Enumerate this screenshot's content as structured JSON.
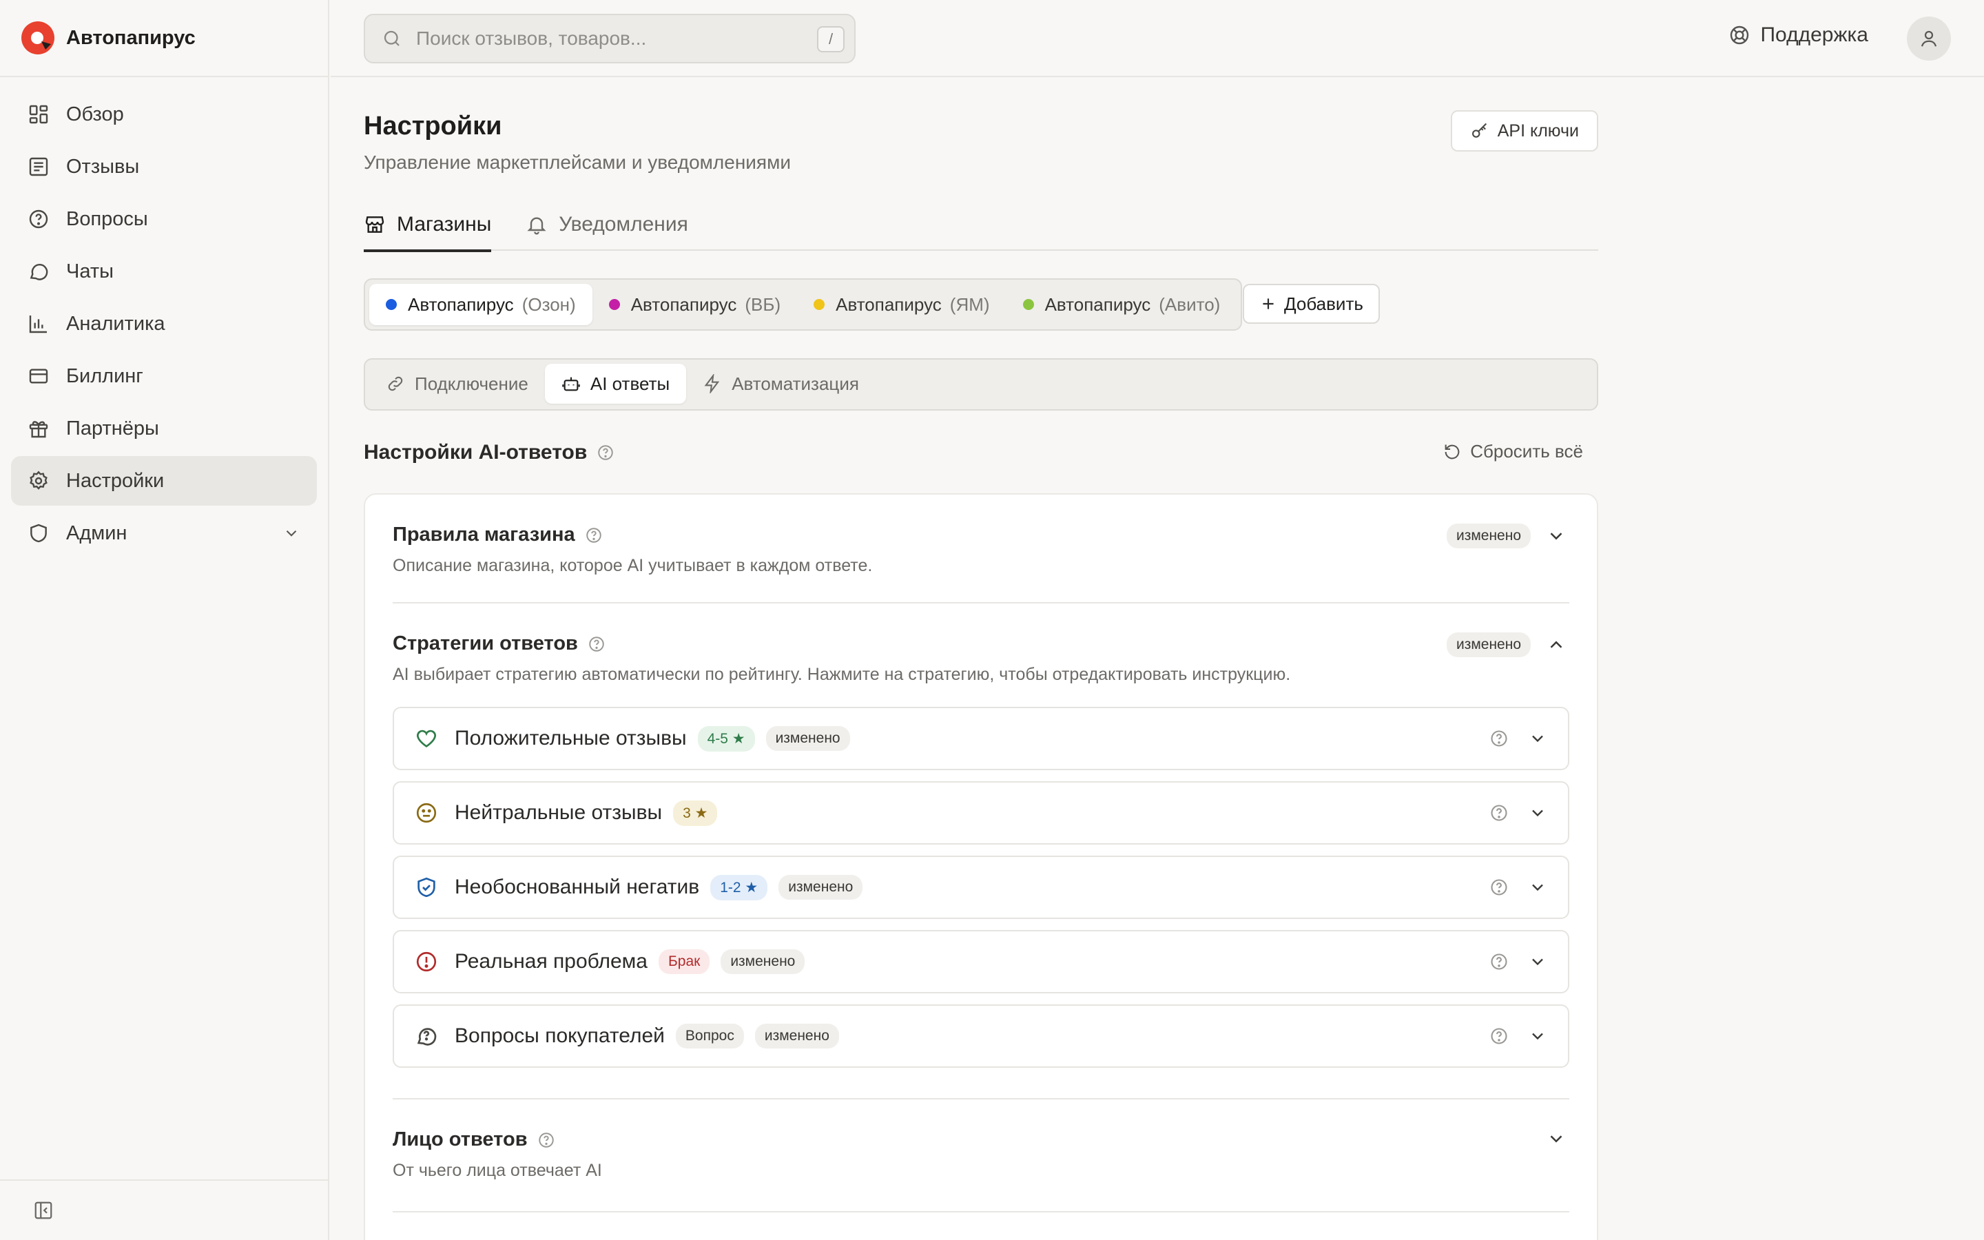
{
  "brand": {
    "name": "Автопапирус"
  },
  "sidebar": {
    "items": [
      {
        "label": "Обзор",
        "icon": "grid-icon"
      },
      {
        "label": "Отзывы",
        "icon": "reviews-icon"
      },
      {
        "label": "Вопросы",
        "icon": "question-icon"
      },
      {
        "label": "Чаты",
        "icon": "chat-icon"
      },
      {
        "label": "Аналитика",
        "icon": "chart-icon"
      },
      {
        "label": "Биллинг",
        "icon": "card-icon"
      },
      {
        "label": "Партнёры",
        "icon": "gift-icon"
      },
      {
        "label": "Настройки",
        "icon": "gear-icon",
        "active": true
      },
      {
        "label": "Админ",
        "icon": "shield-icon"
      }
    ]
  },
  "topbar": {
    "search_placeholder": "Поиск отзывов, товаров...",
    "search_shortcut": "/",
    "support_label": "Поддержка"
  },
  "page": {
    "title": "Настройки",
    "subtitle": "Управление маркетплейсами и уведомлениями",
    "api_button": "API ключи"
  },
  "tabs": [
    {
      "label": "Магазины",
      "active": true
    },
    {
      "label": "Уведомления",
      "active": false
    }
  ],
  "stores": [
    {
      "name": "Автопапирус",
      "marketplace": "(Озон)",
      "color": "#1a5de0",
      "active": true
    },
    {
      "name": "Автопапирус",
      "marketplace": "(ВБ)",
      "color": "#c41fa6",
      "active": false
    },
    {
      "name": "Автопапирус",
      "marketplace": "(ЯМ)",
      "color": "#f0c419",
      "active": false
    },
    {
      "name": "Автопапирус",
      "marketplace": "(Авито)",
      "color": "#8bc53f",
      "active": false
    }
  ],
  "add_store_label": "Добавить",
  "subtabs": [
    {
      "label": "Подключение",
      "active": false
    },
    {
      "label": "AI ответы",
      "active": true
    },
    {
      "label": "Автоматизация",
      "active": false
    }
  ],
  "section": {
    "title": "Настройки AI-ответов",
    "reset_label": "Сбросить всё"
  },
  "blocks": {
    "rules": {
      "title": "Правила магазина",
      "desc": "Описание магазина, которое AI учитывает в каждом ответе.",
      "badge": "изменено"
    },
    "strategies": {
      "title": "Стратегии ответов",
      "desc": "AI выбирает стратегию автоматически по рейтингу. Нажмите на стратегию, чтобы отредактировать инструкцию.",
      "badge": "изменено"
    },
    "persona": {
      "title": "Лицо ответов",
      "desc": "От чьего лица отвечает AI"
    }
  },
  "strategies": [
    {
      "name": "Положительные отзывы",
      "tag": "4-5 ★",
      "modified": "изменено"
    },
    {
      "name": "Нейтральные отзывы",
      "tag": "3 ★",
      "modified": ""
    },
    {
      "name": "Необоснованный негатив",
      "tag": "1-2 ★",
      "modified": "изменено"
    },
    {
      "name": "Реальная проблема",
      "tag": "Брак",
      "modified": "изменено"
    },
    {
      "name": "Вопросы покупателей",
      "tag": "Вопрос",
      "modified": "изменено"
    }
  ],
  "colors": {
    "accent_brand": "#e8412f",
    "positive": "#2f7d4a",
    "neutral": "#8a6a14",
    "negative_shield": "#1f5fa8",
    "problem": "#b22b2b"
  }
}
